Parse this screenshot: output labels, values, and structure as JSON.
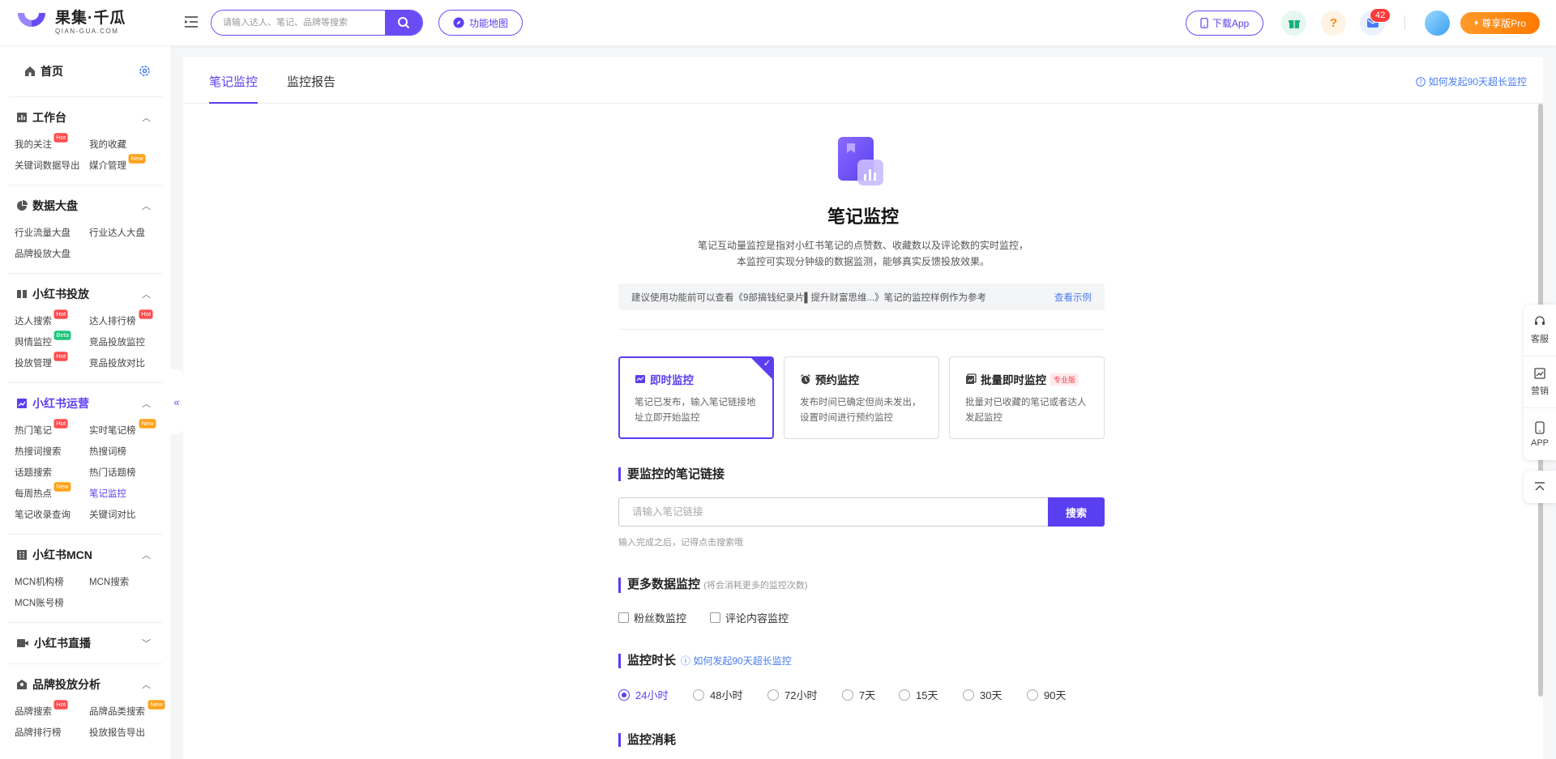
{
  "header": {
    "logo_cn": "果集·千瓜",
    "logo_en": "QIAN-GUA.COM",
    "search_placeholder": "请输入达人、笔记、品牌等搜索",
    "func_map": "功能地图",
    "download_app": "下载App",
    "message_count": "42",
    "vip_label": "尊享版Pro"
  },
  "sidebar": {
    "home": "首页",
    "sections": [
      {
        "title": "工作台",
        "items": [
          {
            "label": "我的关注",
            "tag": "Hot"
          },
          {
            "label": "我的收藏"
          },
          {
            "label": "关键词数据导出"
          },
          {
            "label": "媒介管理",
            "tag": "New"
          }
        ]
      },
      {
        "title": "数据大盘",
        "items": [
          {
            "label": "行业流量大盘"
          },
          {
            "label": "行业达人大盘"
          },
          {
            "label": "品牌投放大盘"
          }
        ]
      },
      {
        "title": "小红书投放",
        "items": [
          {
            "label": "达人搜索",
            "tag": "Hot"
          },
          {
            "label": "达人排行榜",
            "tag": "Hot"
          },
          {
            "label": "舆情监控",
            "tag": "Beta"
          },
          {
            "label": "竞品投放监控"
          },
          {
            "label": "投放管理",
            "tag": "Hot"
          },
          {
            "label": "竞品投放对比"
          }
        ]
      },
      {
        "title": "小红书运营",
        "items": [
          {
            "label": "热门笔记",
            "tag": "Hot"
          },
          {
            "label": "实时笔记榜",
            "tag": "New"
          },
          {
            "label": "热搜词搜索"
          },
          {
            "label": "热搜词榜"
          },
          {
            "label": "话题搜索"
          },
          {
            "label": "热门话题榜"
          },
          {
            "label": "每周热点",
            "tag": "New"
          },
          {
            "label": "笔记监控"
          },
          {
            "label": "笔记收录查询"
          },
          {
            "label": "关键词对比"
          }
        ]
      },
      {
        "title": "小红书MCN",
        "items": [
          {
            "label": "MCN机构榜"
          },
          {
            "label": "MCN搜索"
          },
          {
            "label": "MCN账号榜"
          }
        ]
      },
      {
        "title": "小红书直播",
        "items": []
      },
      {
        "title": "品牌投放分析",
        "items": [
          {
            "label": "品牌搜索",
            "tag": "Hot"
          },
          {
            "label": "品牌品类搜索",
            "tag": "New"
          },
          {
            "label": "品牌排行榜"
          },
          {
            "label": "投放报告导出"
          }
        ]
      }
    ]
  },
  "main": {
    "tabs": [
      "笔记监控",
      "监控报告"
    ],
    "help_link": "如何发起90天超长监控",
    "title": "笔记监控",
    "desc_line1": "笔记互动量监控是指对小红书笔记的点赞数、收藏数以及评论数的实时监控，",
    "desc_line2": "本监控可实现分钟级的数据监测，能够真实反馈投放效果。",
    "tip_text": "建议使用功能前可以查看《9部搞钱纪录片▌提升财富思维...》笔记的监控样例作为参考",
    "tip_link": "查看示例",
    "cards": [
      {
        "title": "即时监控",
        "desc": "笔记已发布，输入笔记链接地 址立即开始监控"
      },
      {
        "title": "预约监控",
        "desc": "发布时间已确定但尚未发出，设置时间进行预约监控"
      },
      {
        "title": "批量即时监控",
        "tag": "专业版",
        "desc": "批量对已收藏的笔记或者达人发起监控"
      }
    ],
    "link_section": "要监控的笔记链接",
    "link_placeholder": "请输入笔记链接",
    "search_btn": "搜索",
    "hint": "输入完成之后，记得点击搜索哦",
    "more_section": "更多数据监控",
    "more_sub": "(将会消耗更多的监控次数)",
    "checks": [
      "粉丝数监控",
      "评论内容监控"
    ],
    "duration_section": "监控时长",
    "duration_link": "如何发起90天超长监控",
    "durations": [
      "24小时",
      "48小时",
      "72小时",
      "7天",
      "15天",
      "30天",
      "90天"
    ],
    "selected_duration": "24小时",
    "consume_section": "监控消耗"
  },
  "float": [
    "客服",
    "营销",
    "APP"
  ],
  "colors": {
    "primary": "#5a3ff0",
    "link": "#4a7cf5",
    "hot": "#ff4d4f",
    "new": "#ffa21a",
    "beta": "#1ec67a",
    "vip": "#ff8a00"
  }
}
